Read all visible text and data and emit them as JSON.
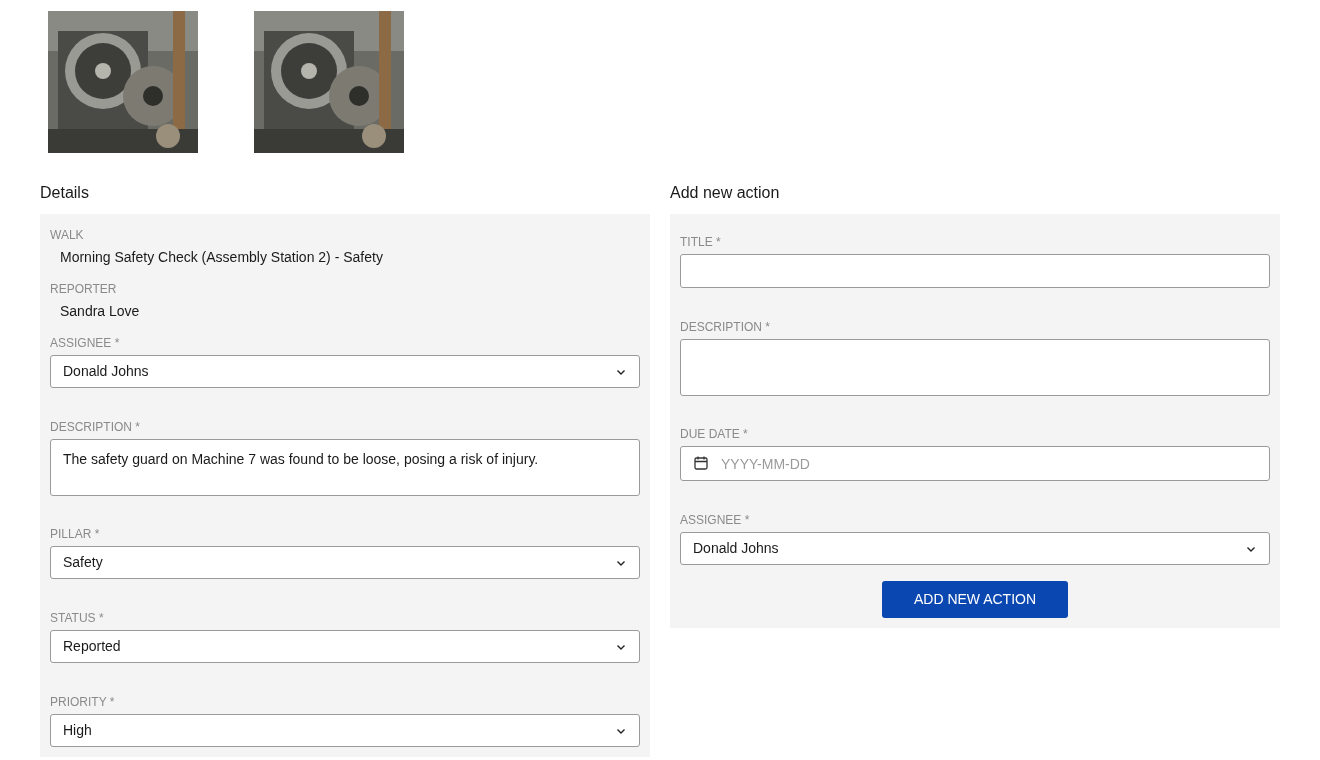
{
  "details": {
    "heading": "Details",
    "fields": [
      {
        "kind": "readonly",
        "label": "WALK",
        "value": "Morning Safety Check (Assembly Station 2) - Safety"
      },
      {
        "kind": "readonly",
        "label": "REPORTER",
        "value": "Sandra Love"
      },
      {
        "kind": "select",
        "label": "ASSIGNEE *",
        "value": "Donald Johns"
      },
      {
        "kind": "textarea",
        "label": "DESCRIPTION *",
        "value": "The safety guard on Machine 7 was found to be loose, posing a risk of injury."
      },
      {
        "kind": "select",
        "label": "PILLAR *",
        "value": "Safety"
      },
      {
        "kind": "select",
        "label": "STATUS *",
        "value": "Reported"
      },
      {
        "kind": "select",
        "label": "PRIORITY *",
        "value": "High"
      }
    ]
  },
  "new_action": {
    "heading": "Add new action",
    "fields": [
      {
        "kind": "input",
        "label": "TITLE *"
      },
      {
        "kind": "textarea",
        "label": "DESCRIPTION *"
      },
      {
        "kind": "date",
        "label": "DUE DATE *",
        "placeholder": "YYYY-MM-DD"
      },
      {
        "kind": "select",
        "label": "ASSIGNEE *",
        "value": "Donald Johns"
      }
    ],
    "button": "ADD NEW ACTION"
  }
}
